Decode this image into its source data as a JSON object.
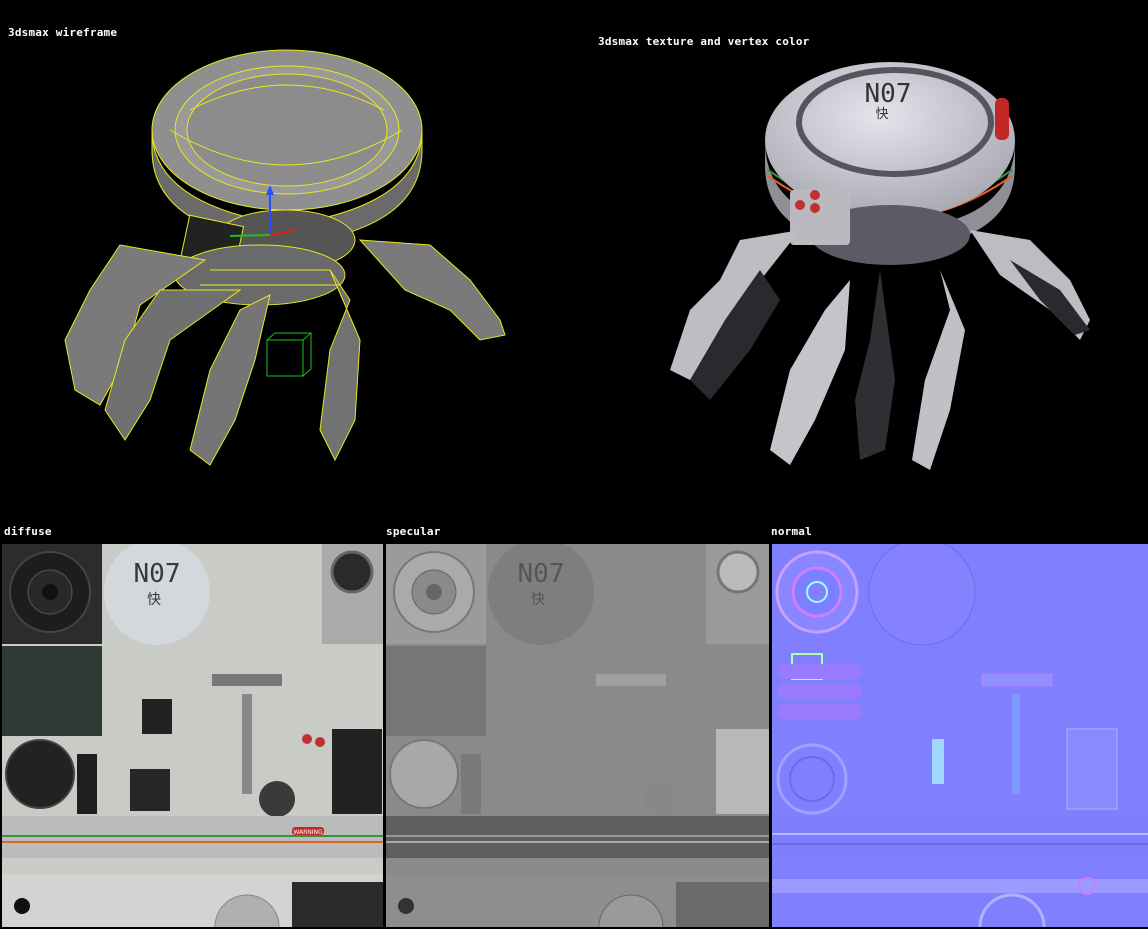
{
  "labels": {
    "wireframe": "3dsmax wireframe",
    "textured": "3dsmax texture and vertex color",
    "diffuse": "diffuse",
    "specular": "specular",
    "normal": "normal"
  },
  "texture_text": {
    "number": "N07",
    "glyph": "快",
    "warning": "WARNING"
  },
  "colors": {
    "background": "#000000",
    "wire": "#e8e81e",
    "gizmo_green": "#19c219",
    "normal_base": "#8080ff",
    "diffuse_base": "#c9ccc6",
    "stripe_orange": "#e0622a"
  }
}
